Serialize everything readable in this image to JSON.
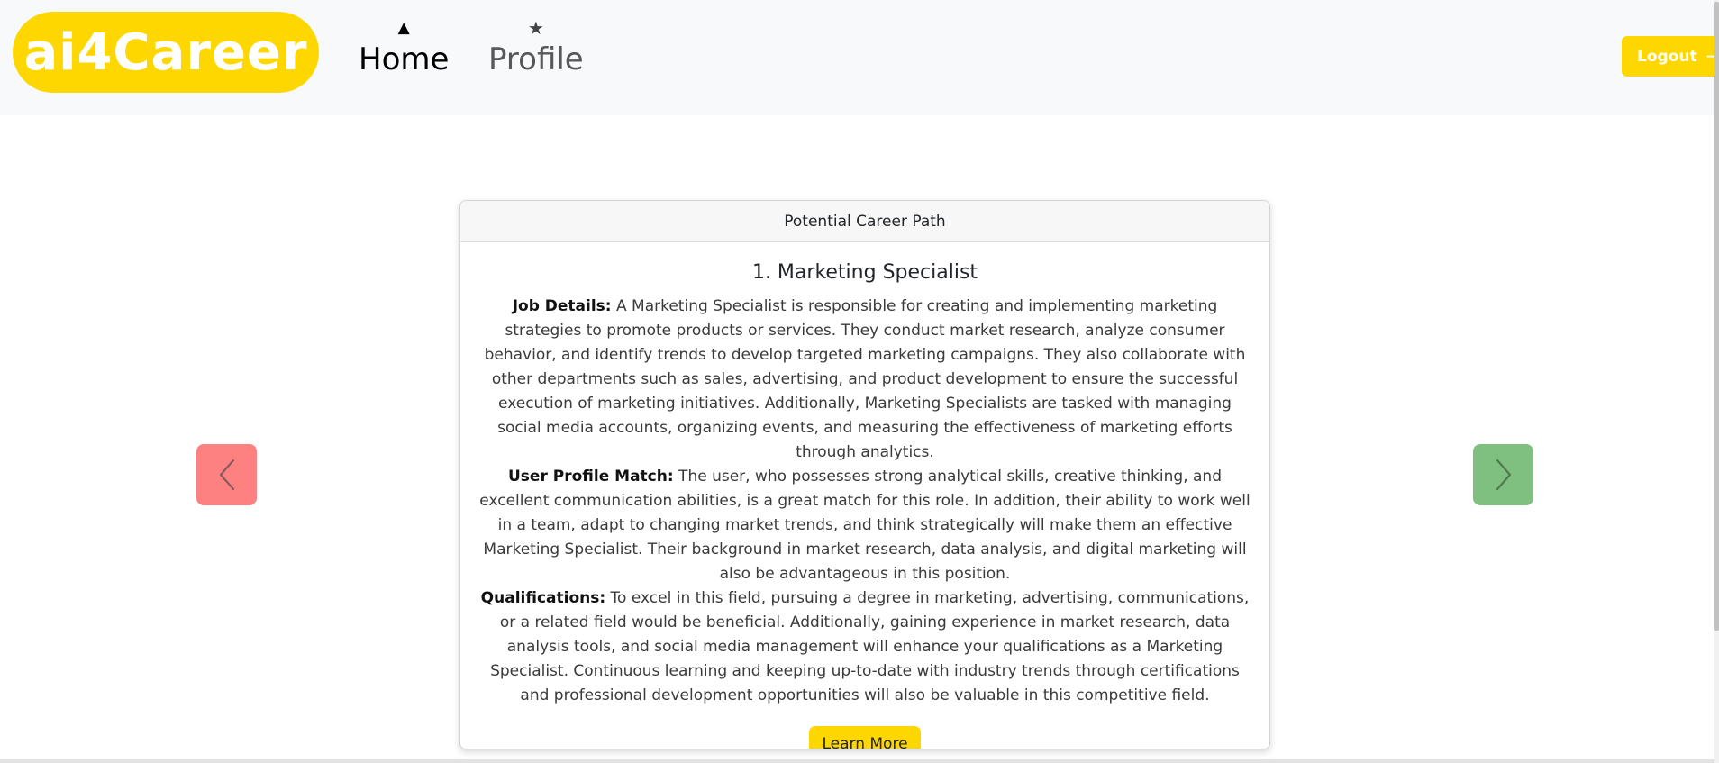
{
  "navbar": {
    "brand": "ai4Career",
    "home_label": "Home",
    "home_icon": "triangle-up-icon",
    "profile_label": "Profile",
    "profile_icon": "star-icon",
    "logout_label": "Logout",
    "logout_icon": "arrow-right-icon",
    "brand_color": "#FFD700"
  },
  "carousel": {
    "prev_icon": "chevron-left-icon",
    "next_icon": "chevron-right-icon",
    "prev_color": "#fe8182",
    "next_color": "#7fbf7f"
  },
  "card": {
    "header": "Potential Career Path",
    "title": "1. Marketing Specialist",
    "job_details_label": "Job Details:",
    "job_details_text": " A Marketing Specialist is responsible for creating and implementing marketing strategies to promote products or services. They conduct market research, analyze consumer behavior, and identify trends to develop targeted marketing campaigns. They also collaborate with other departments such as sales, advertising, and product development to ensure the successful execution of marketing initiatives. Additionally, Marketing Specialists are tasked with managing social media accounts, organizing events, and measuring the effectiveness of marketing efforts through analytics.",
    "profile_match_label": "User Profile Match:",
    "profile_match_text": " The user, who possesses strong analytical skills, creative thinking, and excellent communication abilities, is a great match for this role. In addition, their ability to work well in a team, adapt to changing market trends, and think strategically will make them an effective Marketing Specialist. Their background in market research, data analysis, and digital marketing will also be advantageous in this position.",
    "qualifications_label": "Qualifications:",
    "qualifications_text": " To excel in this field, pursuing a degree in marketing, advertising, communications, or a related field would be beneficial. Additionally, gaining experience in market research, data analysis tools, and social media management will enhance your qualifications as a Marketing Specialist. Continuous learning and keeping up-to-date with industry trends through certifications and professional development opportunities will also be valuable in this competitive field.",
    "learn_more_label": "Learn More"
  }
}
